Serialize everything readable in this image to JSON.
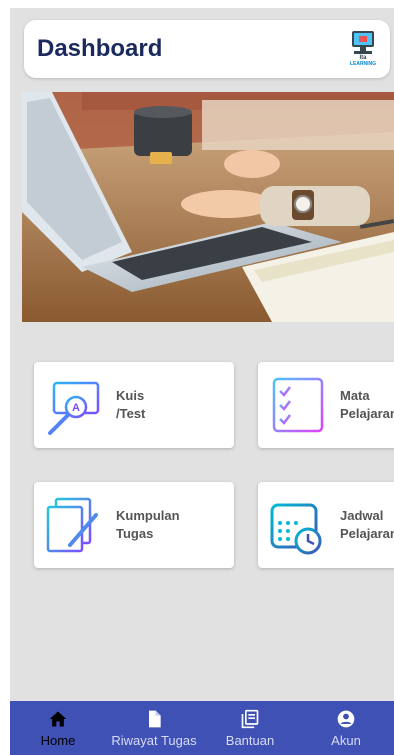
{
  "header": {
    "title": "Dashboard",
    "logo_line1": "Ita",
    "logo_line2": "LEARNING"
  },
  "hero": {
    "icon": "laptop-photo"
  },
  "menu": [
    {
      "label": "Kuis\n/Test",
      "icon": "quiz-search-icon"
    },
    {
      "label": "Mata\nPelajaran",
      "icon": "checklist-icon"
    },
    {
      "label": "Kumpulan\nTugas",
      "icon": "assignment-icon"
    },
    {
      "label": "Jadwal\nPelajaran",
      "icon": "calendar-clock-icon"
    }
  ],
  "bottom_nav": {
    "items": [
      {
        "label": "Home",
        "icon": "home-icon",
        "active": true
      },
      {
        "label": "Riwayat Tugas",
        "icon": "file-icon",
        "active": false
      },
      {
        "label": "Bantuan",
        "icon": "book-icon",
        "active": false
      },
      {
        "label": "Akun",
        "icon": "account-icon",
        "active": false
      }
    ]
  },
  "colors": {
    "nav_background": "#3f51b5",
    "title": "#1b2a5e",
    "page_background": "#e1e1e1"
  }
}
